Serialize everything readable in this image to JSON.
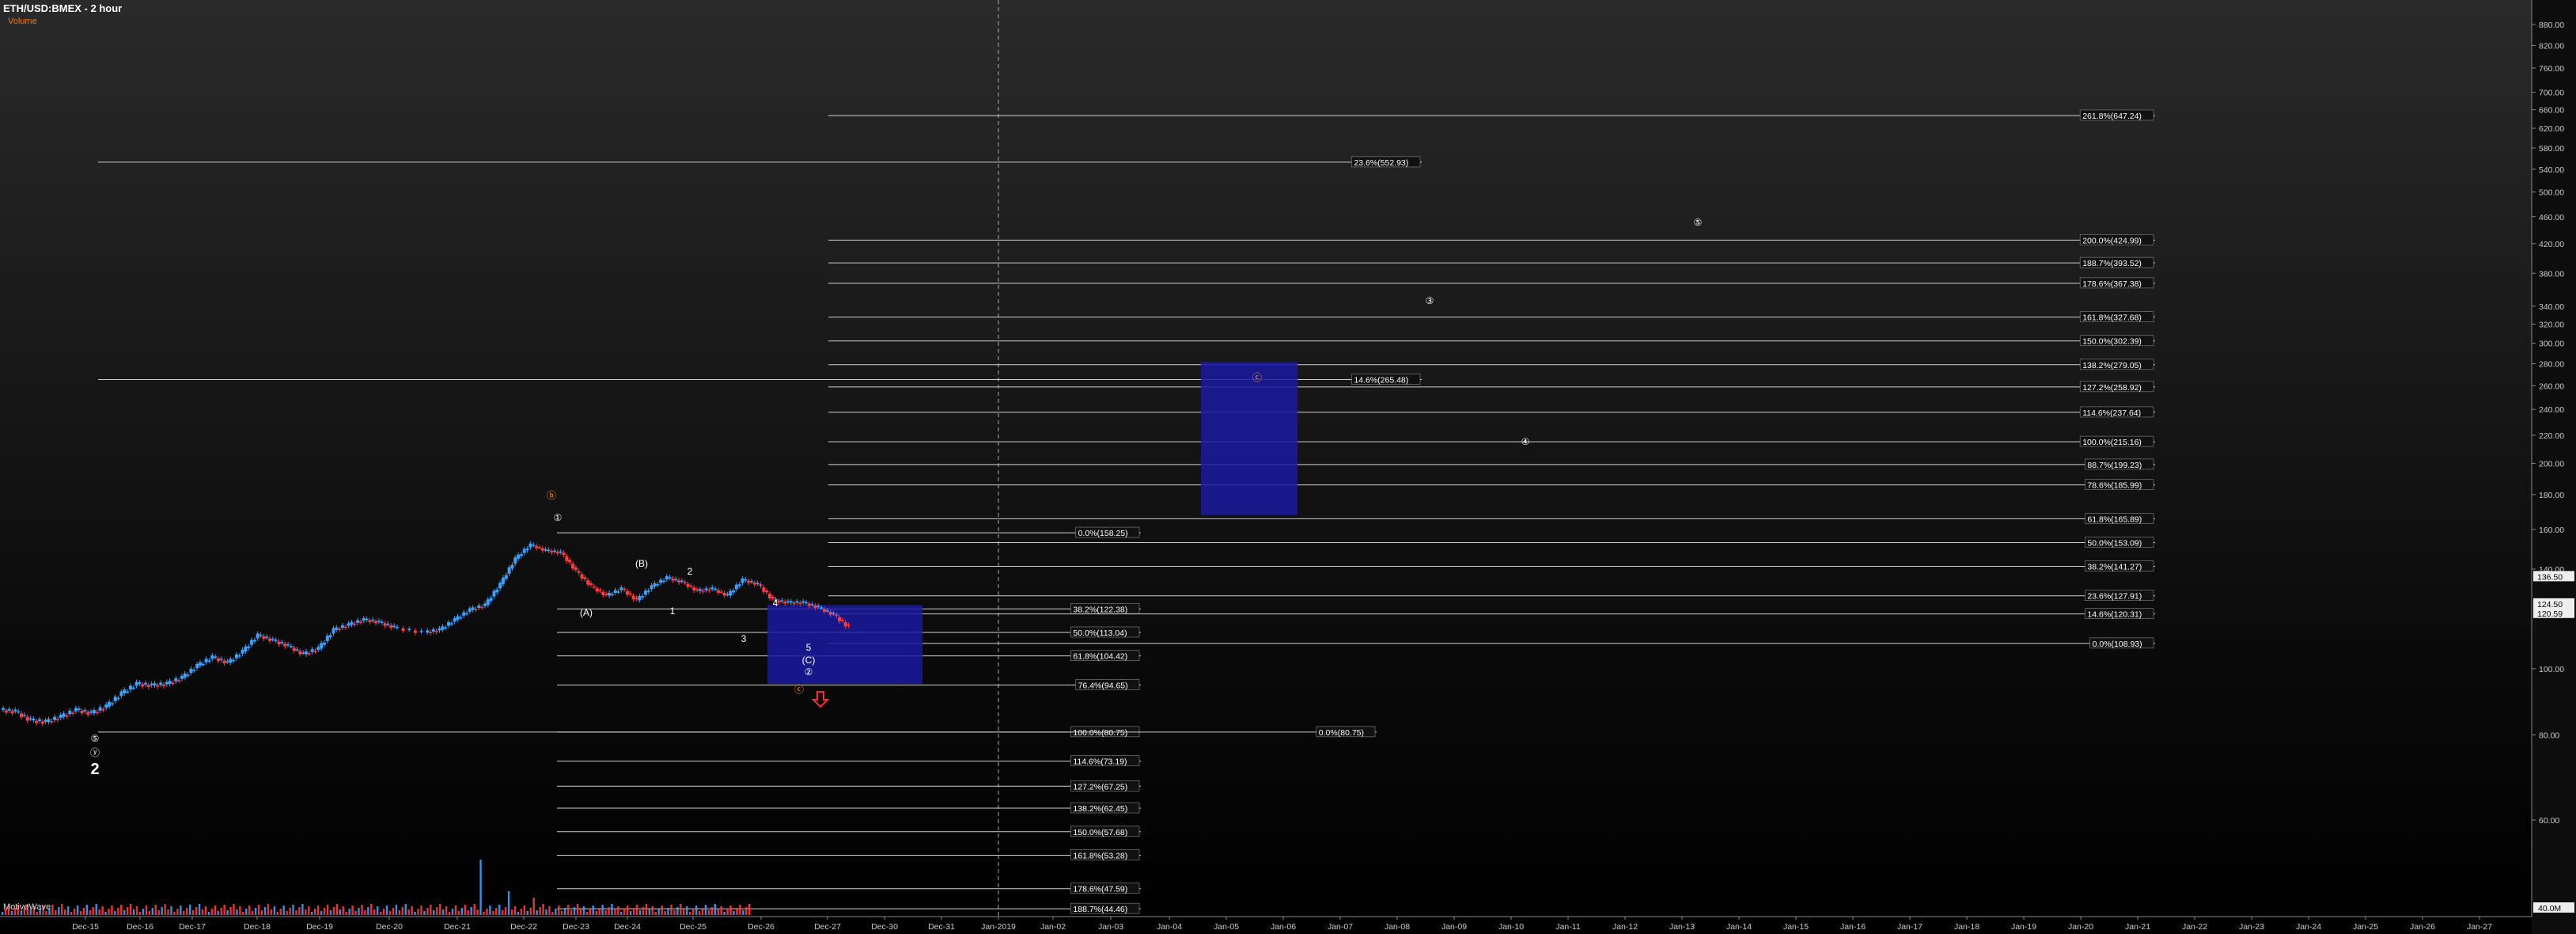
{
  "header": {
    "symbol_title": "ETH/USD:BMEX - 2 hour",
    "volume_label": "Volume"
  },
  "footer": {
    "watermark": "MotiveWave"
  },
  "colors": {
    "grid_line": "#ffffff",
    "up_candle": "#3ba0ff",
    "down_candle": "#ff3b3b",
    "box_fill": "#1a1aa0",
    "label_orange": "#ff9922",
    "label_white": "#ffffff",
    "arrow_red": "#ff2a2a"
  },
  "chart_data": {
    "type": "candlestick",
    "title": "ETH/USD:BMEX - 2 hour",
    "price_axis": {
      "scale": "log",
      "ticks": [
        "880.00",
        "820.00",
        "760.00",
        "700.00",
        "660.00",
        "620.00",
        "580.00",
        "540.00",
        "500.00",
        "460.00",
        "420.00",
        "380.00",
        "340.00",
        "320.00",
        "300.00",
        "280.00",
        "260.00",
        "240.00",
        "220.00",
        "200.00",
        "180.00",
        "160.00",
        "140.00",
        "100.00",
        "80.00",
        "60.00"
      ],
      "price_badges": [
        "136.50",
        "124.50",
        "120.59"
      ],
      "volume_badge": "40.0M"
    },
    "time_axis": {
      "labels": [
        "Dec-15",
        "Dec-16",
        "Dec-17",
        "Dec-18",
        "Dec-19",
        "Dec-20",
        "Dec-21",
        "Dec-22",
        "Dec-23",
        "Dec-24",
        "Dec-25",
        "Dec-26",
        "Dec-27",
        "Dec-30",
        "Dec-31",
        "Jan-2019",
        "Jan-02",
        "Jan-03",
        "Jan-04",
        "Jan-05",
        "Jan-06",
        "Jan-07",
        "Jan-08",
        "Jan-09",
        "Jan-10",
        "Jan-11",
        "Jan-12",
        "Jan-13",
        "Jan-14",
        "Jan-15",
        "Jan-16",
        "Jan-17",
        "Jan-18",
        "Jan-19",
        "Jan-20",
        "Jan-21",
        "Jan-22",
        "Jan-23",
        "Jan-24",
        "Jan-25",
        "Jan-26",
        "Jan-27"
      ]
    },
    "price_path": [
      [
        0,
        87
      ],
      [
        0.5,
        86.5
      ],
      [
        1,
        84
      ],
      [
        1.5,
        83.5
      ],
      [
        2,
        85
      ],
      [
        2.5,
        87
      ],
      [
        3,
        86
      ],
      [
        3.5,
        88
      ],
      [
        4,
        92
      ],
      [
        4.5,
        95
      ],
      [
        5,
        94.5
      ],
      [
        5.5,
        95
      ],
      [
        6,
        97
      ],
      [
        6.5,
        101
      ],
      [
        7,
        104
      ],
      [
        7.5,
        102
      ],
      [
        8,
        106
      ],
      [
        8.5,
        112
      ],
      [
        9,
        110
      ],
      [
        9.5,
        108
      ],
      [
        10,
        105
      ],
      [
        10.5,
        107
      ],
      [
        11,
        114
      ],
      [
        11.5,
        116
      ],
      [
        12,
        118
      ],
      [
        12.5,
        117
      ],
      [
        13,
        115
      ],
      [
        14,
        113
      ],
      [
        14.5,
        114
      ],
      [
        15,
        118
      ],
      [
        15.5,
        122
      ],
      [
        16,
        124
      ],
      [
        16.5,
        133
      ],
      [
        17,
        145
      ],
      [
        17.5,
        152
      ],
      [
        18,
        149
      ],
      [
        18.5,
        148
      ],
      [
        19,
        139
      ],
      [
        19.5,
        132
      ],
      [
        20,
        128
      ],
      [
        20.5,
        131
      ],
      [
        21,
        126
      ],
      [
        21.5,
        132
      ],
      [
        22,
        136
      ],
      [
        22.5,
        134
      ],
      [
        23,
        130
      ],
      [
        23.5,
        131
      ],
      [
        24,
        128
      ],
      [
        24.5,
        135
      ],
      [
        25,
        133
      ],
      [
        25.5,
        126
      ],
      [
        26,
        125
      ],
      [
        26.5,
        125
      ],
      [
        27,
        123
      ],
      [
        27.5,
        120
      ],
      [
        28,
        115
      ]
    ],
    "fib_levels": [
      {
        "label": "261.8%(647.24)",
        "price": 647.24
      },
      {
        "label": "23.6%(552.93)",
        "price": 552.93
      },
      {
        "label": "200.0%(424.99)",
        "price": 424.99
      },
      {
        "label": "188.7%(393.52)",
        "price": 393.52
      },
      {
        "label": "178.6%(367.38)",
        "price": 367.38
      },
      {
        "label": "161.8%(327.68)",
        "price": 327.68
      },
      {
        "label": "150.0%(302.39)",
        "price": 302.39
      },
      {
        "label": "138.2%(279.05)",
        "price": 279.05
      },
      {
        "label": "14.6%(265.48)",
        "price": 265.48
      },
      {
        "label": "127.2%(258.92)",
        "price": 258.92
      },
      {
        "label": "114.6%(237.64)",
        "price": 237.64
      },
      {
        "label": "100.0%(215.16)",
        "price": 215.16
      },
      {
        "label": "88.7%(199.23)",
        "price": 199.23
      },
      {
        "label": "78.6%(185.99)",
        "price": 185.99
      },
      {
        "label": "61.8%(165.89)",
        "price": 165.89
      },
      {
        "label": "0.0%(158.25)",
        "price": 158.25
      },
      {
        "label": "50.0%(153.09)",
        "price": 153.09
      },
      {
        "label": "38.2%(141.27)",
        "price": 141.27
      },
      {
        "label": "23.6%(127.91)",
        "price": 127.91
      },
      {
        "label": "38.2%(122.38)",
        "price": 122.38
      },
      {
        "label": "14.6%(120.31)",
        "price": 120.31
      },
      {
        "label": "50.0%(113.04)",
        "price": 113.04
      },
      {
        "label": "0.0%(108.93)",
        "price": 108.93
      },
      {
        "label": "61.8%(104.42)",
        "price": 104.42
      },
      {
        "label": "76.4%(94.65)",
        "price": 94.65
      },
      {
        "label": "100.0%(80.75)",
        "price": 80.75
      },
      {
        "label": "0.0%(80.75)",
        "price": 80.75
      },
      {
        "label": "114.6%(73.19)",
        "price": 73.19
      },
      {
        "label": "127.2%(67.25)",
        "price": 67.25
      },
      {
        "label": "138.2%(62.45)",
        "price": 62.45
      },
      {
        "label": "150.0%(57.68)",
        "price": 57.68
      },
      {
        "label": "161.8%(53.28)",
        "price": 53.28
      },
      {
        "label": "178.6%(47.59)",
        "price": 47.59
      },
      {
        "label": "188.7%(44.46)",
        "price": 44.46
      }
    ],
    "target_boxes": [
      {
        "price_high": 124,
        "price_low": 95,
        "from": "Dec-26",
        "to": "Dec-31"
      },
      {
        "price_high": 282,
        "price_low": 168,
        "from": "Jan-05",
        "to": "Jan-06"
      }
    ],
    "wave_labels": [
      {
        "text": "⑤",
        "price": 85,
        "color": "white"
      },
      {
        "text": "ⓨ",
        "price": 81,
        "color": "white"
      },
      {
        "text": "2",
        "price": 77,
        "color": "white"
      },
      {
        "text": "ⓑ",
        "price": 167,
        "color": "orange"
      },
      {
        "text": "①",
        "price": 160,
        "color": "white"
      },
      {
        "text": "(B)",
        "price": 137,
        "color": "white"
      },
      {
        "text": "2",
        "price": 134,
        "color": "white"
      },
      {
        "text": "(A)",
        "price": 120,
        "color": "white"
      },
      {
        "text": "1",
        "price": 121,
        "color": "white"
      },
      {
        "text": "4",
        "price": 124,
        "color": "white"
      },
      {
        "text": "3",
        "price": 116,
        "color": "white"
      },
      {
        "text": "5",
        "price": 111,
        "color": "white"
      },
      {
        "text": "(C)",
        "price": 107,
        "color": "white"
      },
      {
        "text": "②",
        "price": 103,
        "color": "white"
      },
      {
        "text": "ⓒ",
        "price": 94,
        "color": "orange"
      },
      {
        "text": "ⓒ",
        "price": 262,
        "color": "orange"
      },
      {
        "text": "③",
        "price": 350,
        "color": "white"
      },
      {
        "text": "④",
        "price": 212,
        "color": "white"
      },
      {
        "text": "⑤",
        "price": 450,
        "color": "white"
      }
    ]
  }
}
